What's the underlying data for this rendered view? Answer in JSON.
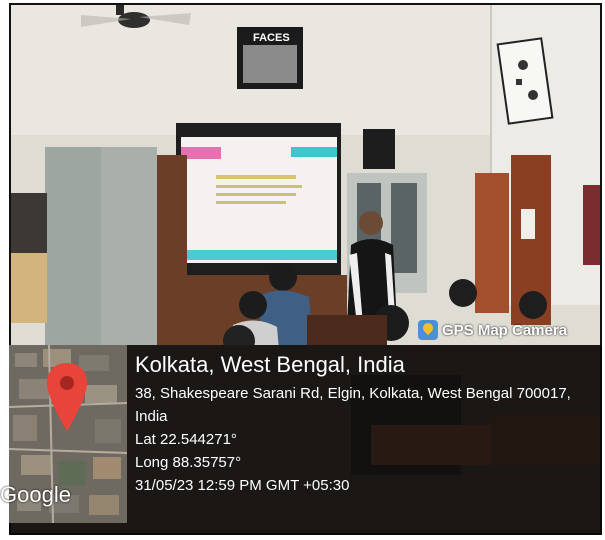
{
  "badge": {
    "label": "GPS Map Camera",
    "icon": "camera-pin-icon"
  },
  "location": {
    "city": "Kolkata, West Bengal, India",
    "address_line1": "38, Shakespeare Sarani Rd, Elgin, Kolkata, West Bengal 700017,",
    "address_line2": "India",
    "lat": "Lat 22.544271°",
    "long": "Long 88.35757°",
    "timestamp": "31/05/23 12:59 PM GMT +05:30"
  },
  "map": {
    "provider": "Google",
    "pin_color": "#e8443a"
  },
  "scene": {
    "wall_sign": "FACES",
    "colors": {
      "wall": "#e6e4dc",
      "cabinet": "#9ea6a2",
      "door": "#a34e2c",
      "screen": "#f4f1f0"
    }
  }
}
